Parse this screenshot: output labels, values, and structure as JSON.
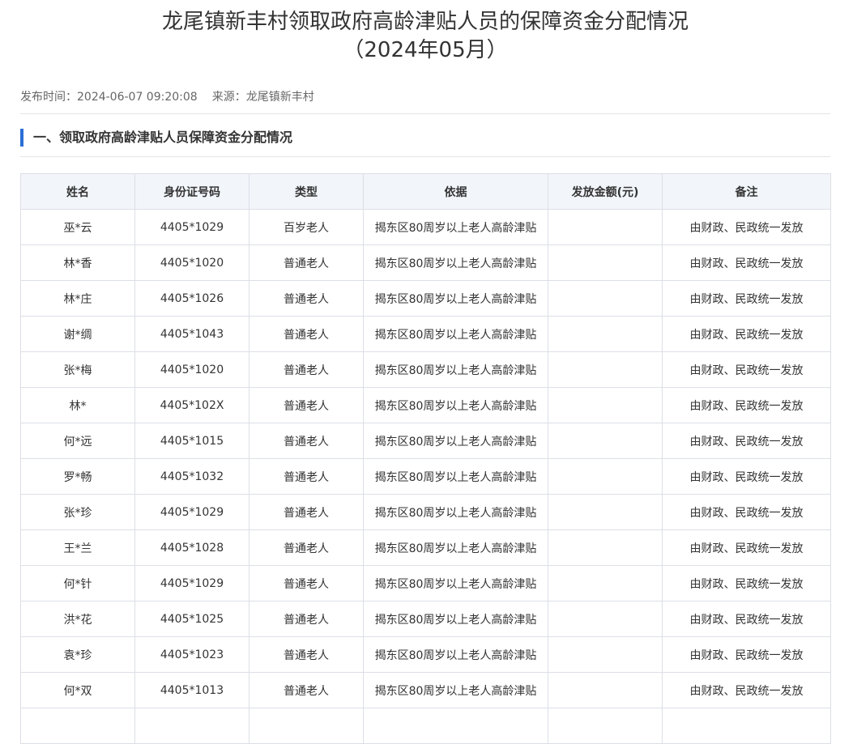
{
  "article": {
    "title_line1": "龙尾镇新丰村领取政府高龄津贴人员的保障资金分配情况",
    "title_line2": "（2024年05月）",
    "publish_label": "发布时间：",
    "publish_time": "2024-06-07 09:20:08",
    "source_label": "来源：",
    "source": "龙尾镇新丰村",
    "section_heading": "一、领取政府高龄津贴人员保障资金分配情况"
  },
  "table": {
    "headers": [
      "姓名",
      "身份证号码",
      "类型",
      "依据",
      "发放金额(元)",
      "备注"
    ],
    "rows": [
      [
        "巫*云",
        "4405*1029",
        "百岁老人",
        "揭东区80周岁以上老人高龄津贴",
        "",
        "由财政、民政统一发放"
      ],
      [
        "林*香",
        "4405*1020",
        "普通老人",
        "揭东区80周岁以上老人高龄津贴",
        "",
        "由财政、民政统一发放"
      ],
      [
        "林*庄",
        "4405*1026",
        "普通老人",
        "揭东区80周岁以上老人高龄津贴",
        "",
        "由财政、民政统一发放"
      ],
      [
        "谢*绸",
        "4405*1043",
        "普通老人",
        "揭东区80周岁以上老人高龄津贴",
        "",
        "由财政、民政统一发放"
      ],
      [
        "张*梅",
        "4405*1020",
        "普通老人",
        "揭东区80周岁以上老人高龄津贴",
        "",
        "由财政、民政统一发放"
      ],
      [
        "林*",
        "4405*102X",
        "普通老人",
        "揭东区80周岁以上老人高龄津贴",
        "",
        "由财政、民政统一发放"
      ],
      [
        "何*远",
        "4405*1015",
        "普通老人",
        "揭东区80周岁以上老人高龄津贴",
        "",
        "由财政、民政统一发放"
      ],
      [
        "罗*畅",
        "4405*1032",
        "普通老人",
        "揭东区80周岁以上老人高龄津贴",
        "",
        "由财政、民政统一发放"
      ],
      [
        "张*珍",
        "4405*1029",
        "普通老人",
        "揭东区80周岁以上老人高龄津贴",
        "",
        "由财政、民政统一发放"
      ],
      [
        "王*兰",
        "4405*1028",
        "普通老人",
        "揭东区80周岁以上老人高龄津贴",
        "",
        "由财政、民政统一发放"
      ],
      [
        "何*针",
        "4405*1029",
        "普通老人",
        "揭东区80周岁以上老人高龄津贴",
        "",
        "由财政、民政统一发放"
      ],
      [
        "洪*花",
        "4405*1025",
        "普通老人",
        "揭东区80周岁以上老人高龄津贴",
        "",
        "由财政、民政统一发放"
      ],
      [
        "袁*珍",
        "4405*1023",
        "普通老人",
        "揭东区80周岁以上老人高龄津贴",
        "",
        "由财政、民政统一发放"
      ],
      [
        "何*双",
        "4405*1013",
        "普通老人",
        "揭东区80周岁以上老人高龄津贴",
        "",
        "由财政、民政统一发放"
      ],
      [
        "",
        "",
        "",
        "",
        "",
        ""
      ]
    ]
  },
  "colors": {
    "accent": "#2b6fd6",
    "header_bg": "#f2f6fb",
    "border": "#dcdfe6"
  }
}
